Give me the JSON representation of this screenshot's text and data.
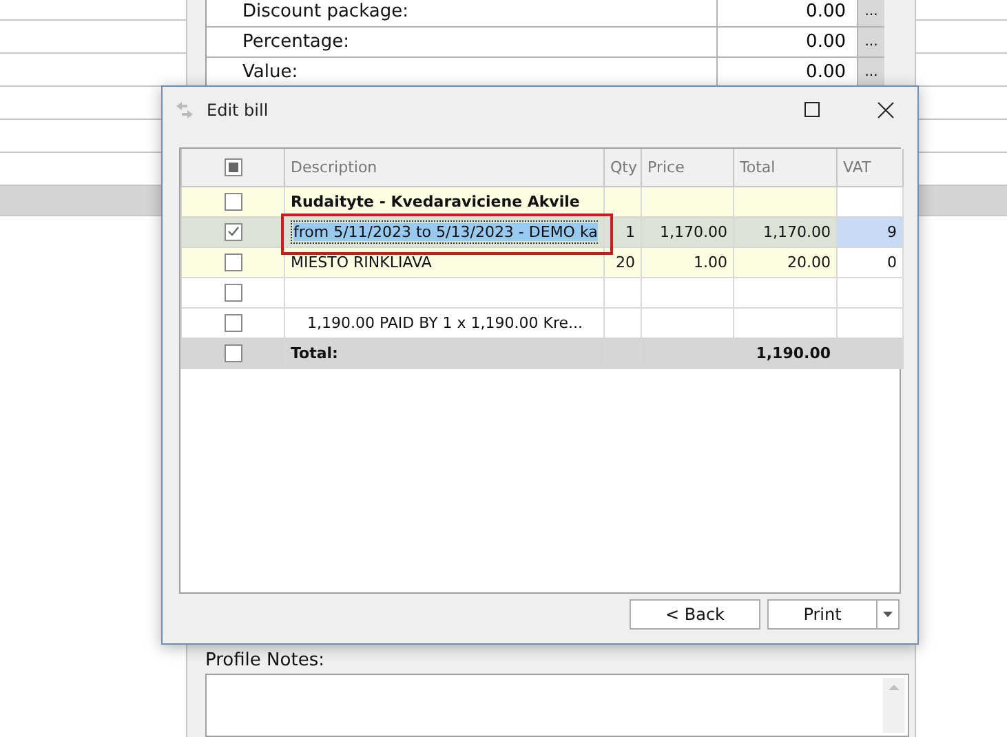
{
  "background_form": {
    "rows": [
      {
        "label": "Discount package:",
        "value": "0.00",
        "button": "..."
      },
      {
        "label": "Percentage:",
        "value": "0.00",
        "button": "..."
      },
      {
        "label": "Value:",
        "value": "0.00",
        "button": "..."
      }
    ],
    "notes_label": "Profile Notes:"
  },
  "dialog": {
    "title": "Edit bill",
    "select_all_partial": true,
    "columns": [
      "Description",
      "Qty",
      "Price",
      "Total",
      "VAT"
    ],
    "rows": [
      {
        "kind": "group",
        "checked": false,
        "selected": false,
        "description": "Rudaityte - Kvedaraviciene Akvile"
      },
      {
        "kind": "item",
        "checked": true,
        "selected": true,
        "editing": true,
        "description": "from 5/11/2023 to 5/13/2023 - DEMO ka",
        "qty": "1",
        "price": "1,170.00",
        "total": "1,170.00",
        "vat": "9"
      },
      {
        "kind": "item",
        "checked": false,
        "selected": false,
        "description": "MIESTO RINKLIAVA",
        "qty": "20",
        "price": "1.00",
        "total": "20.00",
        "vat": "0"
      },
      {
        "kind": "blank",
        "checked": false,
        "selected": false
      },
      {
        "kind": "payment",
        "checked": false,
        "selected": false,
        "description": "1,190.00 PAID BY   1 x    1,190.00 Kre..."
      },
      {
        "kind": "total",
        "checked": false,
        "selected": false,
        "description": "Total:",
        "total": "1,190.00"
      }
    ],
    "buttons": {
      "back": "< Back",
      "print": "Print"
    }
  }
}
